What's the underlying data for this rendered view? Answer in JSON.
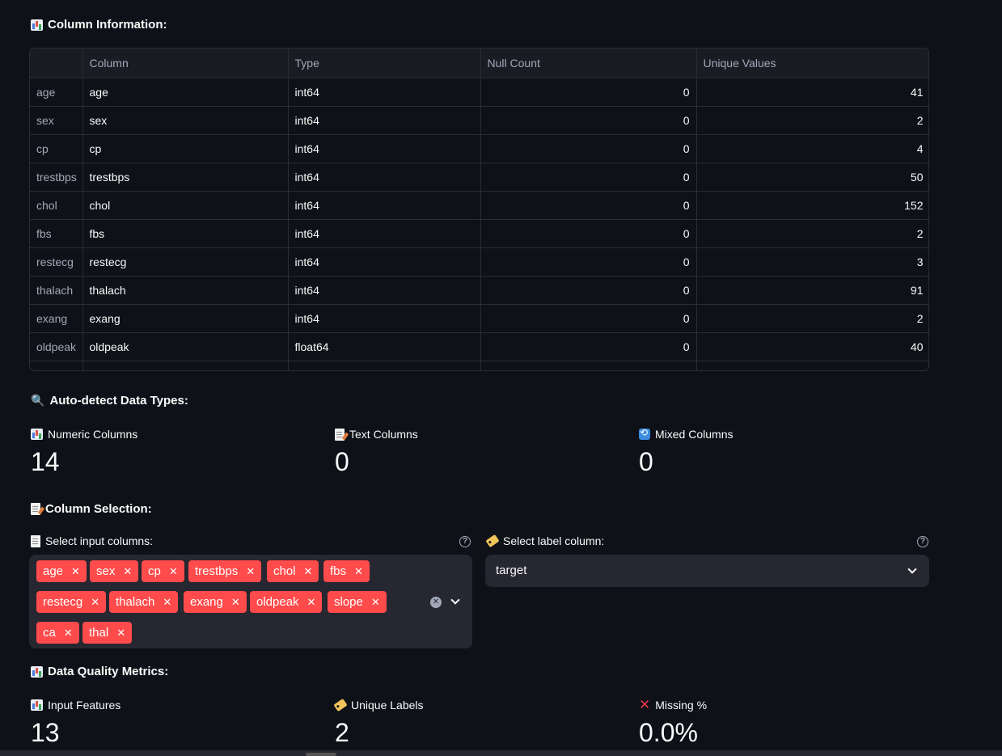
{
  "column_info": {
    "heading": "Column Information:",
    "icon": "bar-chart-emoji-icon",
    "headers": [
      "",
      "Column",
      "Type",
      "Null Count",
      "Unique Values"
    ],
    "rows": [
      {
        "index": "age",
        "column": "age",
        "type": "int64",
        "null_count": "0",
        "unique": "41"
      },
      {
        "index": "sex",
        "column": "sex",
        "type": "int64",
        "null_count": "0",
        "unique": "2"
      },
      {
        "index": "cp",
        "column": "cp",
        "type": "int64",
        "null_count": "0",
        "unique": "4"
      },
      {
        "index": "trestbps",
        "column": "trestbps",
        "type": "int64",
        "null_count": "0",
        "unique": "50"
      },
      {
        "index": "chol",
        "column": "chol",
        "type": "int64",
        "null_count": "0",
        "unique": "152"
      },
      {
        "index": "fbs",
        "column": "fbs",
        "type": "int64",
        "null_count": "0",
        "unique": "2"
      },
      {
        "index": "restecg",
        "column": "restecg",
        "type": "int64",
        "null_count": "0",
        "unique": "3"
      },
      {
        "index": "thalach",
        "column": "thalach",
        "type": "int64",
        "null_count": "0",
        "unique": "91"
      },
      {
        "index": "exang",
        "column": "exang",
        "type": "int64",
        "null_count": "0",
        "unique": "2"
      },
      {
        "index": "oldpeak",
        "column": "oldpeak",
        "type": "float64",
        "null_count": "0",
        "unique": "40"
      }
    ]
  },
  "auto_detect": {
    "heading": "Auto-detect Data Types:",
    "metrics": [
      {
        "label": "Numeric Columns",
        "value": "14",
        "icon": "bar-chart-emoji-icon"
      },
      {
        "label": "Text Columns",
        "value": "0",
        "icon": "memo-emoji-icon"
      },
      {
        "label": "Mixed Columns",
        "value": "0",
        "icon": "arrows-cycle-emoji-icon"
      }
    ]
  },
  "column_selection": {
    "heading": "Column Selection:",
    "input_label": "Select input columns:",
    "label_label": "Select label column:",
    "selected_inputs": [
      "age",
      "sex",
      "cp",
      "trestbps",
      "chol",
      "fbs",
      "restecg",
      "thalach",
      "exang",
      "oldpeak",
      "slope",
      "ca",
      "thal"
    ],
    "label_value": "target",
    "chip_color": "#ff4b4b"
  },
  "quality": {
    "heading": "Data Quality Metrics:",
    "metrics": [
      {
        "label": "Input Features",
        "value": "13",
        "icon": "bar-chart-emoji-icon"
      },
      {
        "label": "Unique Labels",
        "value": "2",
        "icon": "tag-emoji-icon"
      },
      {
        "label": "Missing %",
        "value": "0.0%",
        "icon": "cross-mark-emoji-icon"
      }
    ]
  },
  "colors": {
    "background": "#0e1117",
    "surface": "#262730",
    "accent": "#ff4b4b",
    "border": "#2a2d36",
    "muted_text": "#a3a8b8"
  }
}
